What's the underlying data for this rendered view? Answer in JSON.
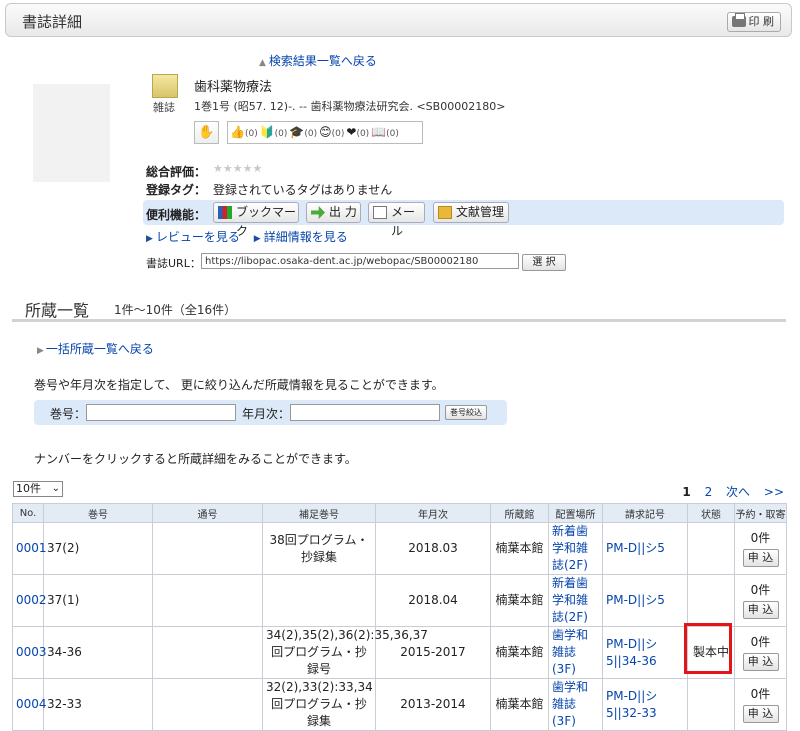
{
  "header": {
    "title": "書誌詳細",
    "print_label": "印 刷"
  },
  "nav": {
    "back_to_results": "検索結果一覧へ戻る"
  },
  "record": {
    "type_label": "雑誌",
    "title": "歯科薬物療法",
    "subtitle": "1巻1号 (昭57. 12)-. -- 歯科薬物療法研究会. <SB00002180>",
    "reactions": [
      {
        "icon": "thumbs-up-icon",
        "glyph": "👍",
        "count": "(0)"
      },
      {
        "icon": "beginner-icon",
        "glyph": "🔰",
        "count": "(0)"
      },
      {
        "icon": "graduation-cap-icon",
        "glyph": "🎓",
        "count": "(0)"
      },
      {
        "icon": "face-icon",
        "glyph": "😊",
        "count": "(0)"
      },
      {
        "icon": "heart-icon",
        "glyph": "❤",
        "count": "(0)"
      },
      {
        "icon": "book-icon",
        "glyph": "📖",
        "count": "(0)"
      }
    ],
    "rating_label": "総合評価：",
    "rating_stars": "★★★★★",
    "tags_label": "登録タグ：",
    "tags_value": "登録されているタグはありません",
    "tools_label": "便利機能：",
    "tools": {
      "bookmark": "ブックマーク",
      "output": "出 力",
      "mail": "メール",
      "refmgr": "文献管理"
    },
    "review_link": "レビューを見る",
    "detail_link": "詳細情報を見る",
    "url_label": "書誌URL：",
    "url_value": "https://libopac.osaka-dent.ac.jp/webopac/SB00002180",
    "select_label": "選 択"
  },
  "holdings": {
    "title": "所蔵一覧",
    "count": "1件～10件（全16件）",
    "bulk_link": "一括所蔵一覧へ戻る",
    "filter_info": "巻号や年月次を指定して、 更に絞り込んだ所蔵情報を見ることができます。",
    "filter": {
      "volume_label": "巻号：",
      "date_label": "年月次：",
      "button": "巻号絞込"
    },
    "click_info": "ナンバーをクリックすると所蔵詳細をみることができます。",
    "per_page": "10件",
    "pager": {
      "p1": "1",
      "p2": "2",
      "next": "次へ",
      "last": ">>"
    },
    "columns": [
      "No.",
      "巻号",
      "通号",
      "補足巻号",
      "年月次",
      "所蔵館",
      "配置場所",
      "請求記号",
      "状態",
      "予約・取寄"
    ],
    "rows": [
      {
        "no": "0001",
        "vol": "37(2)",
        "serial": "",
        "supp": "38回プログラム・抄録集",
        "date": "2018.03",
        "lib": "楠葉本館",
        "loc": "新着歯学和雑誌(2F)",
        "call": "PM-D||シ5",
        "status": "",
        "res_count": "0件",
        "res_btn": "申 込"
      },
      {
        "no": "0002",
        "vol": "37(1)",
        "serial": "",
        "supp": "",
        "date": "2018.04",
        "lib": "楠葉本館",
        "loc": "新着歯学和雑誌(2F)",
        "call": "PM-D||シ5",
        "status": "",
        "res_count": "0件",
        "res_btn": "申 込"
      },
      {
        "no": "0003",
        "vol": "34-36",
        "serial": "",
        "supp": "34(2),35(2),36(2):35,36,37回プログラム・抄録号",
        "date": "2015-2017",
        "lib": "楠葉本館",
        "loc": "歯学和雑誌(3F)",
        "call": "PM-D||シ5||34-36",
        "status": "製本中",
        "res_count": "0件",
        "res_btn": "申 込"
      },
      {
        "no": "0004",
        "vol": "32-33",
        "serial": "",
        "supp": "32(2),33(2):33,34回プログラム・抄録集",
        "date": "2013-2014",
        "lib": "楠葉本館",
        "loc": "歯学和雑誌(3F)",
        "call": "PM-D||シ5||32-33",
        "status": "",
        "res_count": "0件",
        "res_btn": "申 込"
      }
    ]
  },
  "colors": {
    "accent_link": "#0645ad",
    "panel_blue": "#dce9f8",
    "highlight_red": "#e3141a"
  }
}
